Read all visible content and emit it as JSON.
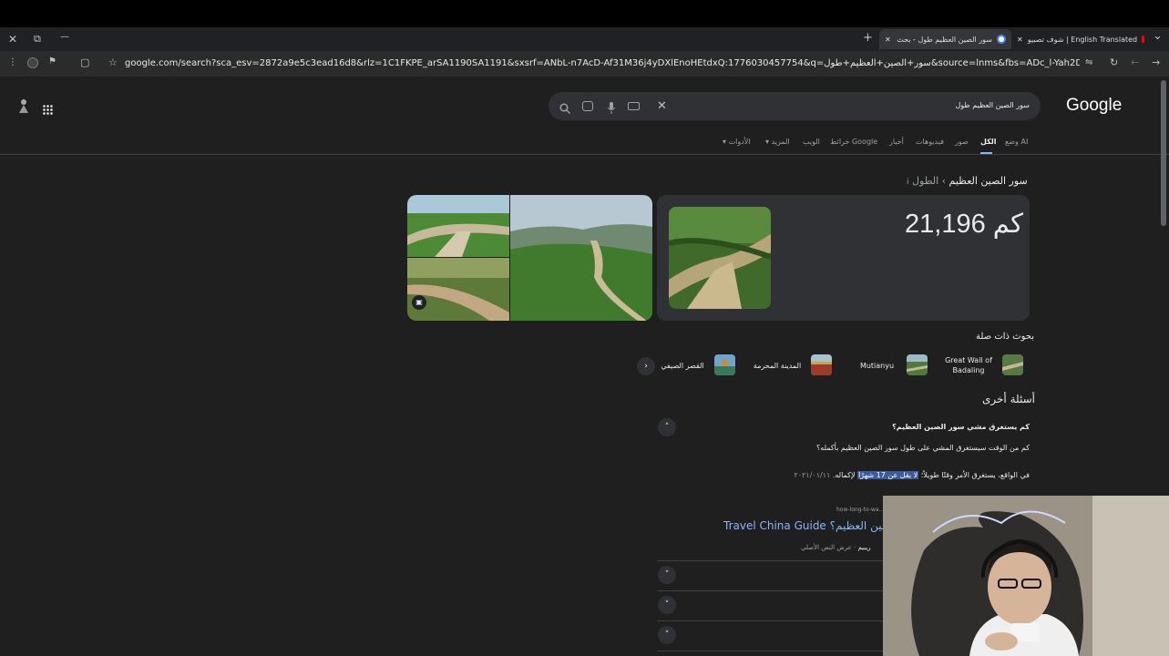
{
  "window": {
    "close_glyph": "✕",
    "restore_glyph": "⧉",
    "minimize_glyph": "—",
    "new_tab_glyph": "+",
    "tab_list_glyph": "⌄"
  },
  "tabs": [
    {
      "title": "سور الصين العظيم طول - بحث",
      "close": "✕"
    },
    {
      "title": "English Translated | شوف تصبيو",
      "close": "✕"
    }
  ],
  "address_bar": {
    "url": "google.com/search?sca_esv=2872a9e5c3ead16d8&rlz=1C1FKPE_arSA1190SA1191&sxsrf=ANbL-n7AcD-Af31M36j4yDXlEnoHEtdxQ:1776030457754&q=سور+الصين+العظيم+طول&source=lnms&fbs=ADc_l-Yah2DOSUVSdw9sSZZinyX4BFeczYOtmqCSGo5g8_XjkFuZ8HX..."
  },
  "google": {
    "logo": "Google",
    "search_query": "سور الصين العظيم طول",
    "nav_tabs": [
      "وضع AI",
      "الكل",
      "صور",
      "فيديوهات",
      "أخبار",
      "خرائط Google",
      "الويب",
      "المزيد",
      "الأدوات"
    ],
    "active_tab": "الكل"
  },
  "answer": {
    "breadcrumb_subject": "سور الصين العظيم",
    "breadcrumb_sep": "›",
    "breadcrumb_attr": "الطول",
    "value": "21,196 كم"
  },
  "related": {
    "heading": "بحوث ذات صلة",
    "items": [
      "Great Wall of Badaling",
      "Mutianyu",
      "المدينة المحرمة",
      "القصر الصيفي"
    ]
  },
  "paa": {
    "heading": "أسئلة أخرى",
    "question": "كم يستغرق مشي سور الصين العظيم؟",
    "subquestion": "كم من الوقت سيستغرق المشي على طول سور الصين العظيم بأكمله؟",
    "answer_pre": "في الواقع، يستغرق الأمر وقتًا طويلاً؛",
    "answer_highlight": "لا يقل عن 17 شهرًا",
    "answer_post": "لإكماله.",
    "answer_date": "٢٠٢١/٠١/١١",
    "source_url": "how-long-to-wa...",
    "source_title_ar": "الصين العظيم؟ -",
    "source_title_en": "Travel China Guide",
    "source_meta": "عرض النص الأصلي",
    "source_meta2": "ريبيم"
  }
}
